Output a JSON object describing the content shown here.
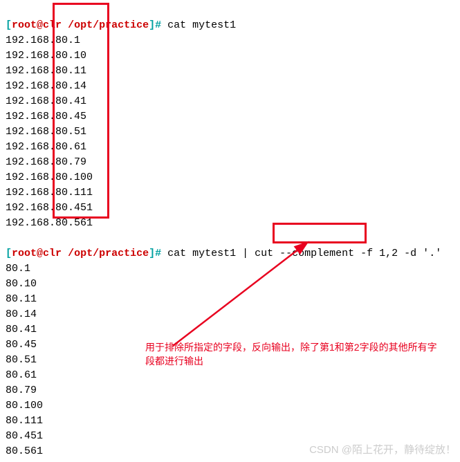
{
  "prompt": {
    "open": "[",
    "user": "root",
    "at": "@",
    "host": "clr",
    "path": " /opt/practice",
    "close": "]",
    "hash": "#"
  },
  "cmd1": " cat mytest1",
  "ips": [
    "192.168.80.1",
    "192.168.80.10",
    "192.168.80.11",
    "192.168.80.14",
    "192.168.80.41",
    "192.168.80.45",
    "192.168.80.51",
    "192.168.80.61",
    "192.168.80.79",
    "192.168.80.100",
    "192.168.80.111",
    "192.168.80.451",
    "192.168.80.561"
  ],
  "cmd2": " cat mytest1 | cut --complement -f 1,2 -d '.'",
  "out2": [
    "80.1",
    "80.10",
    "80.11",
    "80.14",
    "80.41",
    "80.45",
    "80.51",
    "80.61",
    "80.79",
    "80.100",
    "80.111",
    "80.451",
    "80.561"
  ],
  "annotation": "用于排除所指定的字段，反向输出，除了第1和第2字段的其他所有字段都进行输出",
  "watermark": "CSDN @陌上花开，静待绽放！"
}
